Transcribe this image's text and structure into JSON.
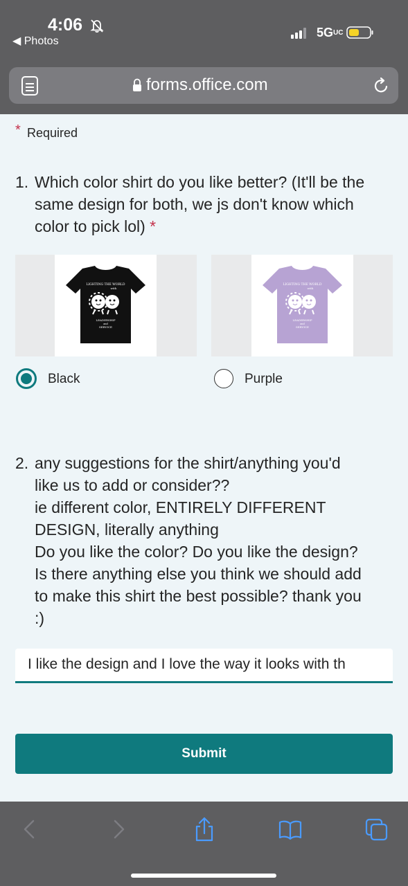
{
  "status_bar": {
    "time": "4:06",
    "back_label": "◀ Photos",
    "network": "5G",
    "network_sub": "UC",
    "icons": [
      "bell-slash-icon",
      "signal-icon",
      "battery-icon"
    ]
  },
  "browser": {
    "url": "forms.office.com",
    "icons": [
      "reader-icon",
      "lock-icon",
      "reload-icon"
    ]
  },
  "form": {
    "required_star": "*",
    "required_label": "Required",
    "question1": {
      "number": "1.",
      "text": "Which color shirt do you like better? (It'll be the\nsame design for both, we js don't know which\ncolor to pick lol)",
      "star": "*",
      "options": [
        {
          "label": "Black",
          "selected": true,
          "shirt_color": "#111111"
        },
        {
          "label": "Purple",
          "selected": false,
          "shirt_color": "#b7a3d3"
        }
      ],
      "shirt_text_top": "LIGHTING THE WORLD",
      "shirt_text_mid": "with",
      "shirt_text_bottom": "LEADERSHIP",
      "shirt_text_and": "and",
      "shirt_text_last": "SERVICE"
    },
    "question2": {
      "number": "2.",
      "text": "any suggestions for the shirt/anything you'd\nlike us to add or consider??\nie different color, ENTIRELY DIFFERENT\nDESIGN, literally anything\nDo you like the color? Do you like the design?\nIs there anything else you think we should add\nto make this shirt the best possible? thank you\n:)",
      "answer_value": "I like the design and I love the way it looks with th"
    },
    "submit_label": "Submit"
  },
  "toolbar": {
    "icons": [
      "back-icon",
      "forward-icon",
      "share-icon",
      "bookmarks-icon",
      "tabs-icon"
    ]
  },
  "colors": {
    "accent": "#0f7a7e",
    "required": "#c4314b",
    "chrome": "#5e5e60",
    "link_icon": "#4a9bff"
  }
}
